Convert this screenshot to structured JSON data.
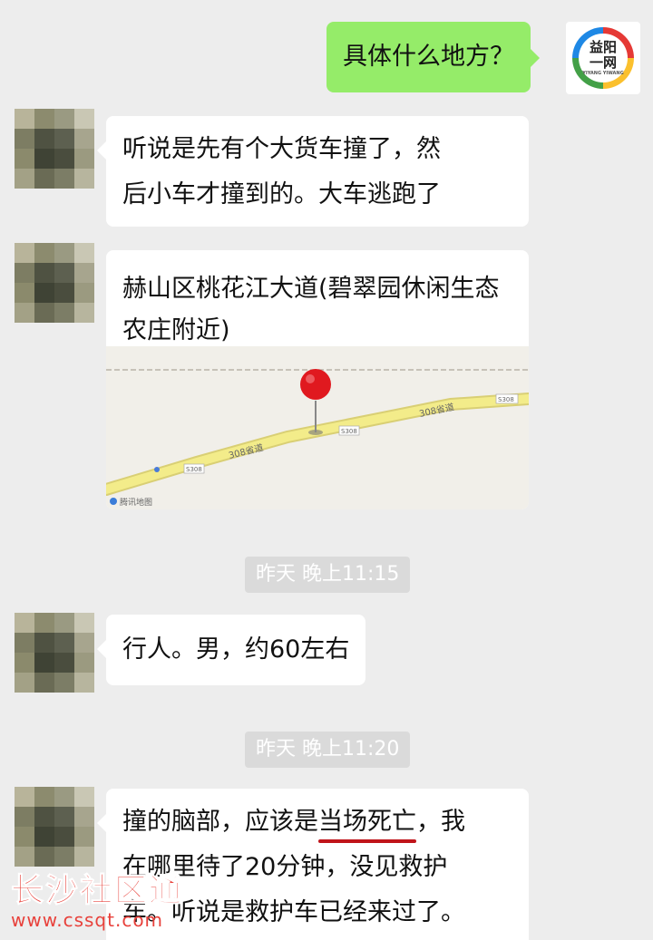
{
  "messages": {
    "sent_question": "具体什么地方？",
    "my_avatar": {
      "line1": "益阳",
      "line2": "一网",
      "sub": "YIYANG YIWANG"
    },
    "msg1": {
      "line1": "听说是先有个大货车撞了，然",
      "line2": "后小车才撞到的。大车逃跑了"
    },
    "location": {
      "title": "赫山区桃花江大道(碧翠园休闲生态农庄附近)",
      "road_name_1": "308省道",
      "road_name_2": "308省道",
      "road_code_1": "S308",
      "road_code_2": "S308",
      "road_code_3": "S308",
      "map_provider": "腾讯地图"
    },
    "time1": "昨天 晚上11:15",
    "msg2": "行人。男，约60左右",
    "time2": "昨天 晚上11:20",
    "msg3": {
      "line1_a": "撞的脑部，应该是",
      "line1_b": "当场死亡",
      "line1_c": "，我",
      "line2": "在哪里待了20分钟，没见救护",
      "line3": "车。听说是救护车已经来过了。"
    }
  },
  "watermark": {
    "title": "长沙社区通",
    "url": "www.cssqt.com"
  },
  "colors": {
    "background": "#ededed",
    "sent_bubble": "#95ec69",
    "received_bubble": "#ffffff",
    "underline": "#c0141a",
    "pin": "#e0191f",
    "road": "#f3ec8a",
    "watermark": "#e8413b"
  }
}
